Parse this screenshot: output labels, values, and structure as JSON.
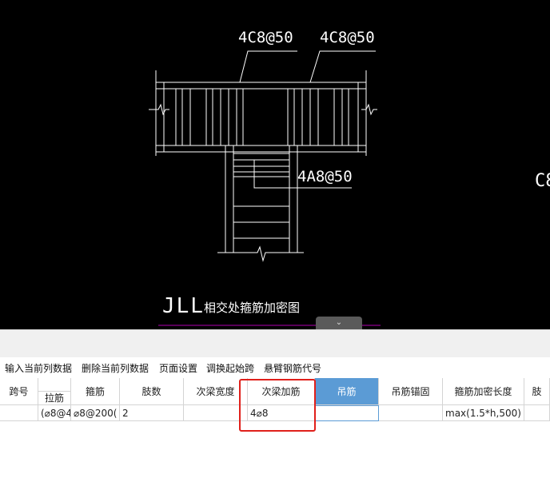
{
  "drawing": {
    "label_top_left": "4C8@50",
    "label_top_right": "4C8@50",
    "label_middle": "4A8@50",
    "label_edge": "C8",
    "title_prefix": "JLL",
    "title_suffix": "相交处箍筋加密图",
    "collapse_icon": "chevron-down-icon",
    "colors": {
      "background": "#000000",
      "lines": "#ffffff",
      "title_underline": "#b000b0"
    }
  },
  "toolbar": {
    "items": [
      "输入当前列数据",
      "删除当前列数据",
      "页面设置",
      "调换起始跨",
      "悬臂钢筋代号"
    ]
  },
  "table": {
    "headers": {
      "span_no": "跨号",
      "tie_bar": "拉筋",
      "stirrup": "箍筋",
      "legs": "肢数",
      "secondary_beam_width": "次梁宽度",
      "secondary_beam_added": "次梁加筋",
      "hanger_bar": "吊筋",
      "hanger_anchor": "吊筋锚固",
      "dense_length": "箍筋加密长度",
      "last_partial": "肢"
    },
    "row": {
      "span_no": "",
      "tie_bar": "(⌀8@4",
      "stirrup": "⌀8@200(",
      "legs": "2",
      "secondary_beam_width": "",
      "secondary_beam_added": "4⌀8",
      "hanger_bar": "",
      "hanger_anchor": "",
      "dense_length": "max(1.5*h,500)",
      "last_partial": ""
    },
    "active_column_color": "#5b9bd5",
    "highlight_color": "#e0201b"
  }
}
